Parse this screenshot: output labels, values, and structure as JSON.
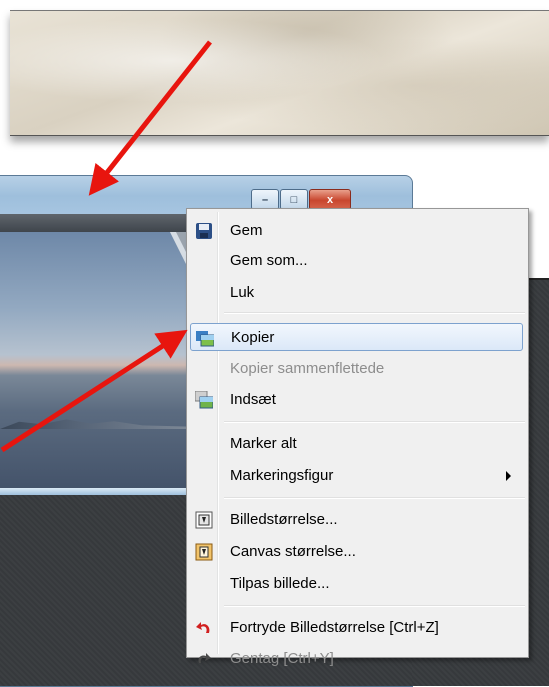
{
  "menu": {
    "items": [
      {
        "label": "Gem",
        "icon": "floppy-disk-icon"
      },
      {
        "label": "Gem som...",
        "icon": ""
      },
      {
        "label": "Luk",
        "icon": ""
      },
      {
        "label": "Kopier",
        "icon": "copy-image-icon",
        "state": "highlighted"
      },
      {
        "label": "Kopier sammenflettede",
        "icon": "",
        "state": "disabled"
      },
      {
        "label": "Indsæt",
        "icon": "paste-image-icon"
      },
      {
        "label": "Marker alt",
        "icon": ""
      },
      {
        "label": "Markeringsfigur",
        "icon": "",
        "submenu": true
      },
      {
        "label": "Billedstørrelse...",
        "icon": "image-size-icon"
      },
      {
        "label": "Canvas størrelse...",
        "icon": "canvas-size-icon"
      },
      {
        "label": "Tilpas billede...",
        "icon": ""
      },
      {
        "label": "Fortryde Billedstørrelse [Ctrl+Z]",
        "icon": "undo-icon"
      },
      {
        "label": "Gentag [Ctrl+Y]",
        "icon": "redo-icon",
        "state": "disabled"
      }
    ]
  },
  "window": {
    "buttons": {
      "minimize": "–",
      "maximize": "□",
      "close": "x"
    }
  },
  "colors": {
    "annotation_arrow": "#e8150e",
    "highlight_border": "#7da2ce",
    "disabled_text": "#8d8d8d"
  }
}
